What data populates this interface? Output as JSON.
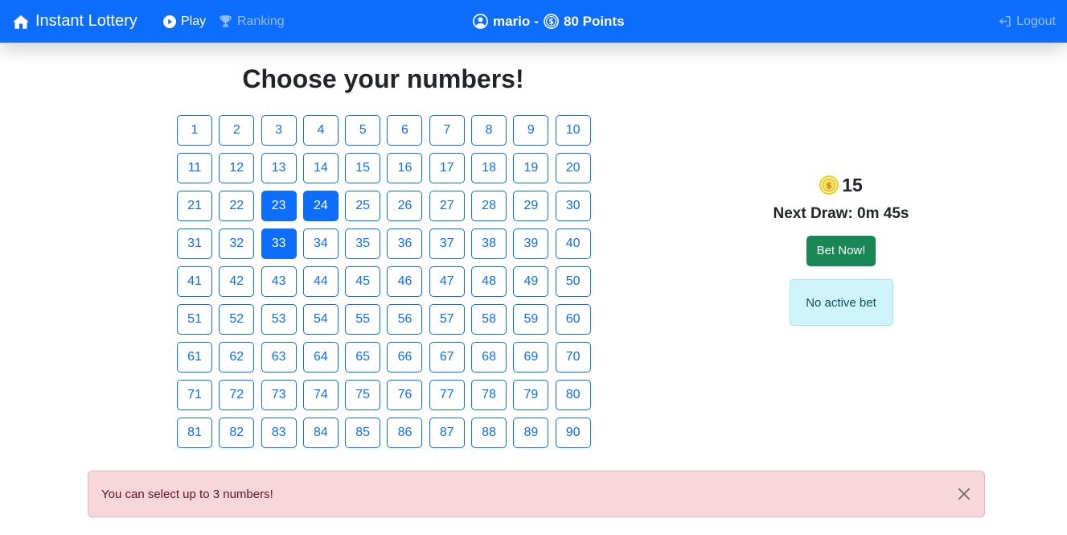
{
  "navbar": {
    "brand": "Instant Lottery",
    "links": {
      "play": "Play",
      "ranking": "Ranking",
      "logout": "Logout"
    },
    "user": {
      "name": "mario",
      "separator": "-",
      "points": "80 Points"
    },
    "colors": {
      "bg": "#0d6efd",
      "active": "#ffffff",
      "muted": "rgba(255,255,255,0.55)"
    }
  },
  "main": {
    "title": "Choose your numbers!",
    "numbers": [
      1,
      2,
      3,
      4,
      5,
      6,
      7,
      8,
      9,
      10,
      11,
      12,
      13,
      14,
      15,
      16,
      17,
      18,
      19,
      20,
      21,
      22,
      23,
      24,
      25,
      26,
      27,
      28,
      29,
      30,
      31,
      32,
      33,
      34,
      35,
      36,
      37,
      38,
      39,
      40,
      41,
      42,
      43,
      44,
      45,
      46,
      47,
      48,
      49,
      50,
      51,
      52,
      53,
      54,
      55,
      56,
      57,
      58,
      59,
      60,
      61,
      62,
      63,
      64,
      65,
      66,
      67,
      68,
      69,
      70,
      71,
      72,
      73,
      74,
      75,
      76,
      77,
      78,
      79,
      80,
      81,
      82,
      83,
      84,
      85,
      86,
      87,
      88,
      89,
      90
    ],
    "selected": [
      23,
      24,
      33
    ]
  },
  "side": {
    "cost": "15",
    "next_draw": "Next Draw: 0m 45s",
    "bet_button": "Bet Now!",
    "active_bet": "No active bet"
  },
  "alert": {
    "message": "You can select up to 3 numbers!"
  },
  "icons": {
    "brand": "house-icon",
    "play": "play-circle-icon",
    "ranking": "trophy-icon",
    "user": "person-circle-icon",
    "points": "coin-icon",
    "logout": "logout-icon",
    "close": "close-icon"
  }
}
